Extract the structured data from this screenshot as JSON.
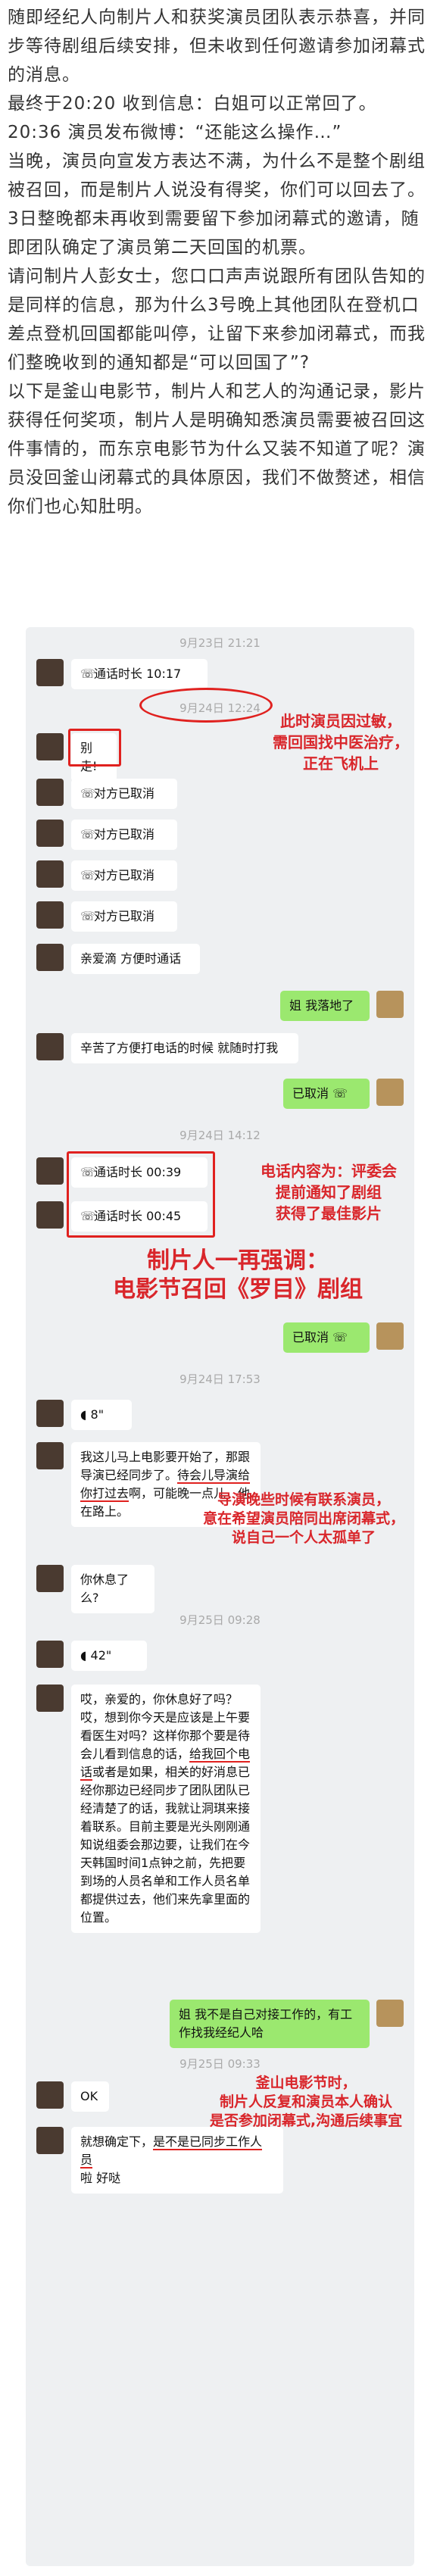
{
  "article": {
    "p1": "随即经纪人向制片人和获奖演员团队表示恭喜，并同步等待剧组后续安排，但未收到任何邀请参加闭幕式的消息。",
    "p2": "最终于20:20 收到信息：白姐可以正常回了。",
    "p3": "20:36 演员发布微博：“还能这么操作…”",
    "p4": "当晚，演员向宣发方表达不满，为什么不是整个剧组被召回，而是制片人说没有得奖，你们可以回去了。",
    "p5": "3日整晚都未再收到需要留下参加闭幕式的邀请，随即团队确定了演员第二天回国的机票。",
    "p6": "请问制片人彭女士，您口口声声说跟所有团队告知的是同样的信息，那为什么3号晚上其他团队在登机口差点登机回国都能叫停，让留下来参加闭幕式，而我们整晚收到的通知都是“可以回国了”?",
    "p7": "以下是釜山电影节，制片人和艺人的沟通记录，影片获得任何奖项，制片人是明确知悉演员需要被召回这件事情的，而东京电影节为什么又装不知道了呢？演员没回釜山闭幕式的具体原因，我们不做赘述，相信你们也心知肚明。"
  },
  "chat": {
    "ts1": "9月23日 21:21",
    "call1": "通话时长 10:17",
    "ts2": "9月24日 12:24",
    "msg_biezou": "别走!",
    "cancel": "对方已取消",
    "msg_qinai": "亲爱滴 方便时通话",
    "msg_luodi": "姐 我落地了",
    "msg_xinku": "辛苦了方便打电话的时候 就随时打我",
    "yiquxiao": "已取消",
    "ts3": "9月24日 14:12",
    "call2": "通话时长 00:39",
    "call3": "通话时长 00:45",
    "ts4": "9月24日 17:53",
    "voice1": "8\"",
    "msg_long1_a": "我这儿马上电影要开始了，那跟导演已经同步了。",
    "msg_long1_b": "待会儿导演给你打过去",
    "msg_long1_c": "啊，可能晚一点儿，他在路上。",
    "msg_xiule": "你休息了么?",
    "ts5": "9月25日 09:28",
    "voice2": "42\"",
    "msg_long2_a": "哎，亲爱的，你休息好了吗？哎，想到你今天是应该是上午要看医生对吗？这样你那个要是待会儿看到信息的话，",
    "msg_long2_b": "给我回个电话",
    "msg_long2_c": "或者是如果，相关的好消息已经你那边已经同步了团队团队已经清楚了的话，我就让洞琪来接着联系。目前主要是光头刚刚通知说组委会那边要，让我们在今天韩国时间1点钟之前，先把要到场的人员名单和工作人员名单都提供过去，他们来先拿里面的位置。",
    "msg_jie": "姐 我不是自己对接工作的，有工作找我经纪人哈",
    "ts6": "9月25日 09:33",
    "msg_ok": "OK",
    "msg_last_a": "就想确定下，",
    "msg_last_b": "是不是已同步工作人员",
    "msg_last_c": "啦 好哒"
  },
  "annotations": {
    "a1_l1": "此时演员因过敏，",
    "a1_l2": "需回国找中医治疗，",
    "a1_l3": "正在飞机上",
    "a2_l1": "电话内容为：评委会",
    "a2_l2": "提前通知了剧组",
    "a2_l3": "获得了最佳影片",
    "a3_l1": "制片人一再强调：",
    "a3_l2": "电影节召回《罗目》剧组",
    "a4_l1": "导演晚些时候有联系演员，",
    "a4_l2": "意在希望演员陪同出席闭幕式，",
    "a4_l3": "说自己一个人太孤单了",
    "a5_l1": "釜山电影节时，",
    "a5_l2": "制片人反复和演员本人确认",
    "a5_l3": "是否参加闭幕式,沟通后续事宜"
  },
  "colors": {
    "annotation": "#d9262b",
    "bubble_right": "#9be86f",
    "chat_bg": "#eef0f2"
  }
}
